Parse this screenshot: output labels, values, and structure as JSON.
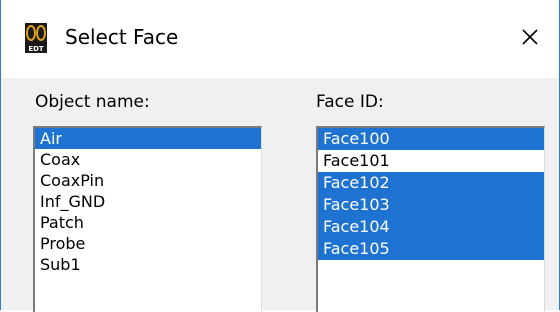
{
  "window": {
    "title": "Select Face",
    "close_glyph": "×",
    "icon": "app-logo-icon",
    "icon_text": "EDT",
    "border_color": "#2b7fd4"
  },
  "object_list": {
    "label": "Object name:",
    "items": [
      {
        "label": "Air",
        "selected": true
      },
      {
        "label": "Coax",
        "selected": false
      },
      {
        "label": "CoaxPin",
        "selected": false
      },
      {
        "label": "Inf_GND",
        "selected": false
      },
      {
        "label": "Patch",
        "selected": false
      },
      {
        "label": "Probe",
        "selected": false
      },
      {
        "label": "Sub1",
        "selected": false
      }
    ]
  },
  "face_list": {
    "label": "Face ID:",
    "items": [
      {
        "label": "Face100",
        "selected": true
      },
      {
        "label": "Face101",
        "selected": false
      },
      {
        "label": "Face102",
        "selected": true
      },
      {
        "label": "Face103",
        "selected": true
      },
      {
        "label": "Face104",
        "selected": true
      },
      {
        "label": "Face105",
        "selected": true
      }
    ]
  },
  "colors": {
    "selection": "#1e73d2",
    "dialog_background": "#f0f0f0"
  }
}
